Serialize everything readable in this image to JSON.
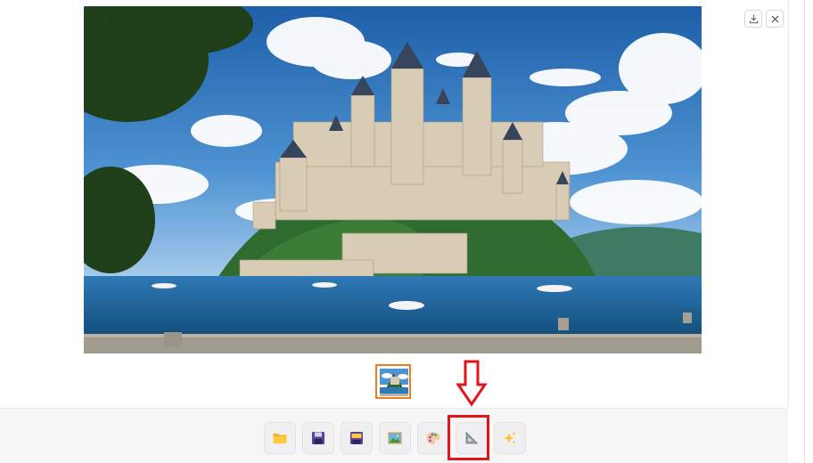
{
  "gallery": {
    "main_image": {
      "alt": "castle-on-island-image"
    },
    "actions": [
      {
        "id": "download",
        "icon": "download-icon"
      },
      {
        "id": "close",
        "icon": "close-icon"
      }
    ],
    "thumbnail": {
      "selected": true
    }
  },
  "toolbar": {
    "buttons": [
      {
        "id": "open",
        "icon": "folder-icon"
      },
      {
        "id": "save",
        "icon": "floppy-disk-icon"
      },
      {
        "id": "save-as",
        "icon": "save-to-archive-icon"
      },
      {
        "id": "image",
        "icon": "picture-icon"
      },
      {
        "id": "palette",
        "icon": "palette-icon"
      },
      {
        "id": "ruler",
        "icon": "triangle-ruler-icon"
      },
      {
        "id": "sparkles",
        "icon": "sparkles-icon"
      }
    ]
  },
  "annotations": {
    "arrow_color": "#e4141b",
    "highlight_color": "#e4141b",
    "thumb_border_color": "#f07c1f"
  }
}
